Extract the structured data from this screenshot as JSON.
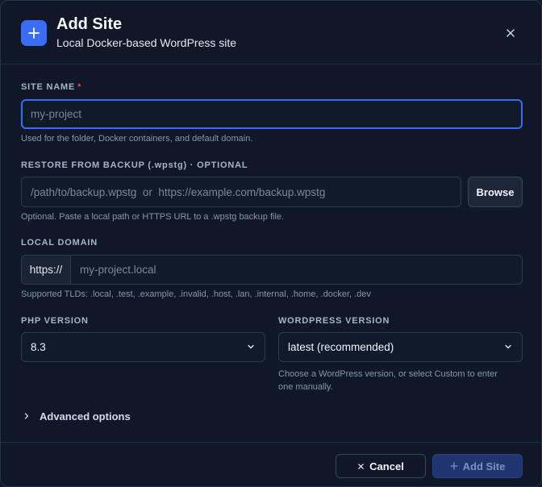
{
  "header": {
    "title": "Add Site",
    "subtitle": "Local Docker-based WordPress site",
    "icon": "plus-icon",
    "close_icon": "close-icon"
  },
  "site_name": {
    "label": "SITE NAME",
    "required_mark": "*",
    "value": "",
    "placeholder": "my-project",
    "help": "Used for the folder, Docker containers, and default domain."
  },
  "restore": {
    "label": "RESTORE FROM BACKUP (.wpstg) · OPTIONAL",
    "value": "",
    "placeholder": "/path/to/backup.wpstg  or  https://example.com/backup.wpstg",
    "browse_label": "Browse",
    "help": "Optional. Paste a local path or HTTPS URL to a .wpstg backup file."
  },
  "domain": {
    "label": "LOCAL DOMAIN",
    "prefix": "https://",
    "value": "",
    "placeholder": "my-project.local",
    "help": "Supported TLDs: .local, .test, .example, .invalid, .host, .lan, .internal, .home, .docker, .dev"
  },
  "php": {
    "label": "PHP VERSION",
    "selected": "8.3"
  },
  "wordpress": {
    "label": "WORDPRESS VERSION",
    "selected": "latest (recommended)",
    "help_line1": "Choose a WordPress version, or select Custom to enter",
    "help_line2": "one manually."
  },
  "advanced": {
    "label": "Advanced options"
  },
  "footer": {
    "cancel_label": "Cancel",
    "add_label": "Add Site"
  },
  "colors": {
    "accent": "#3b6cf5",
    "background": "#0f1729",
    "required": "#ef4444",
    "add_button_disabled": "#1f3470"
  }
}
